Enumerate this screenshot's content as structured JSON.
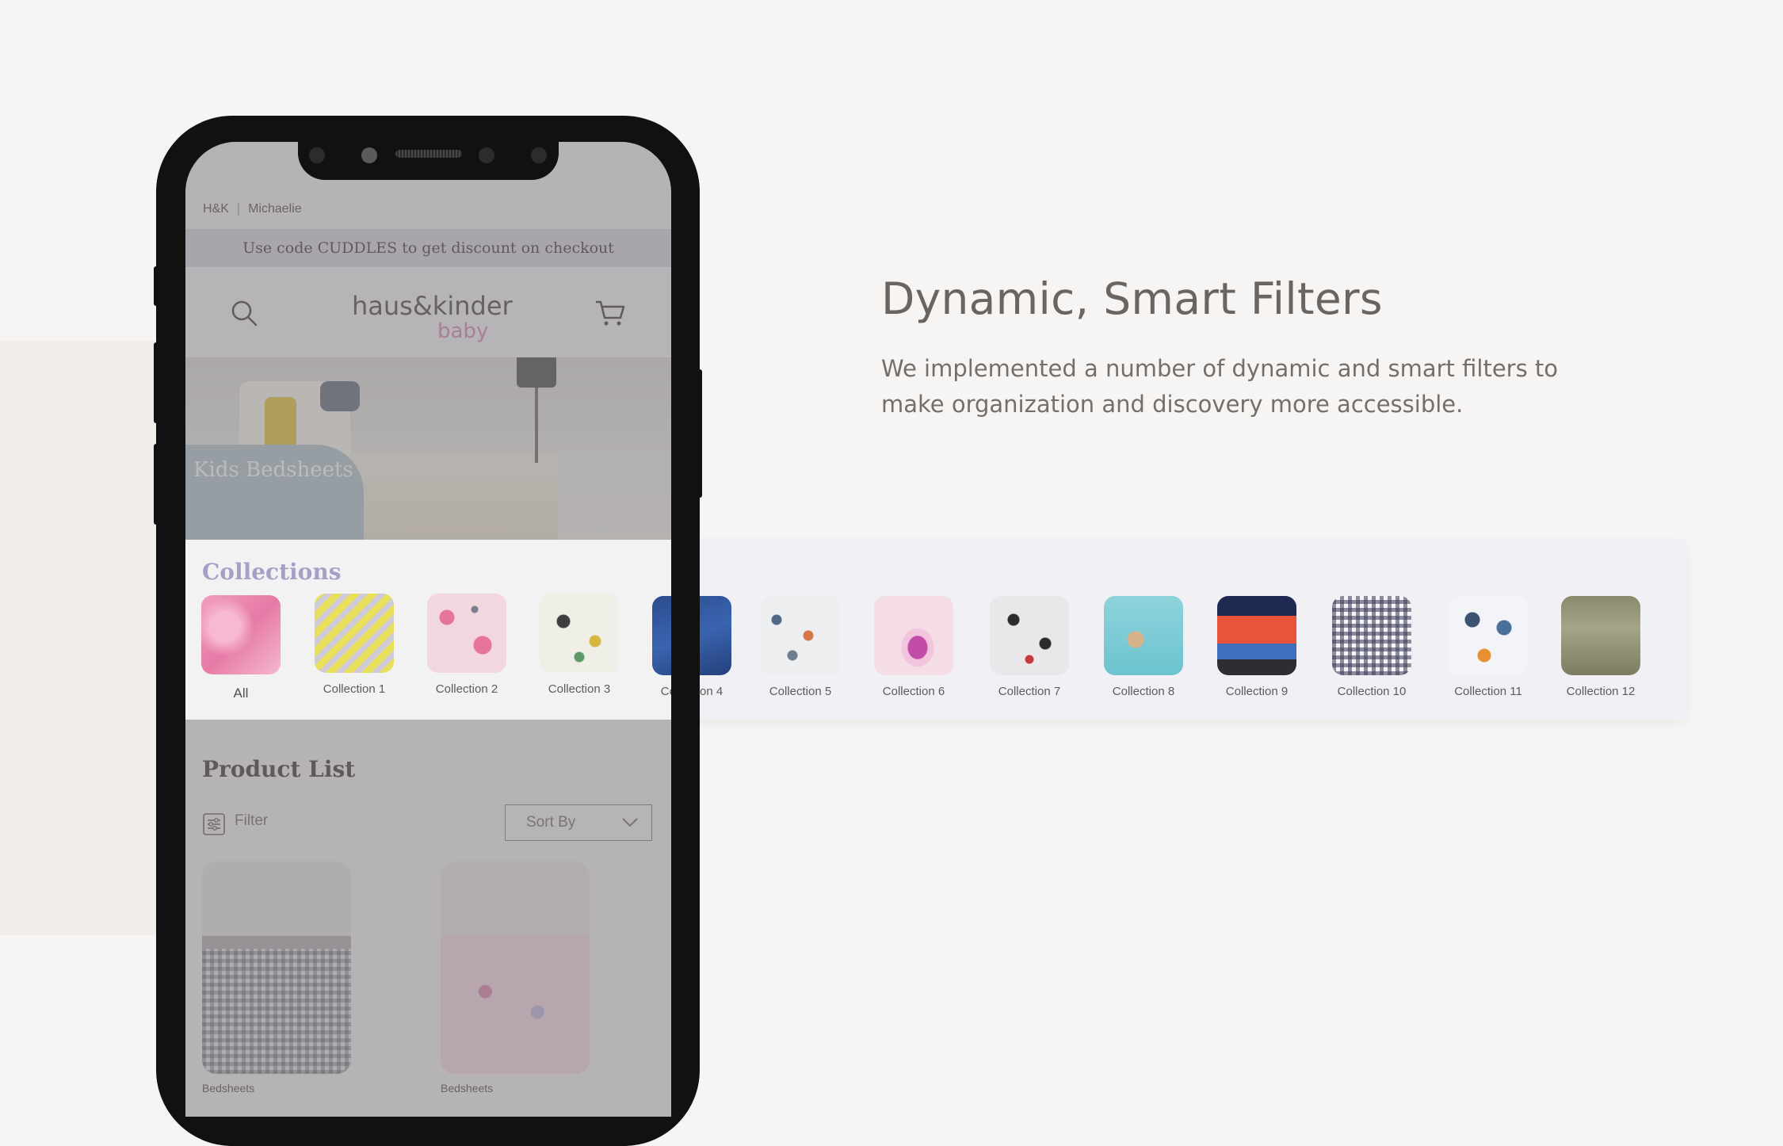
{
  "feature": {
    "title": "Dynamic, Smart Filters",
    "description": "We implemented a number of dynamic and smart filters to make organization and discovery more accessible."
  },
  "phone": {
    "topbar": {
      "brand": "H&K",
      "sub": "Michaelie"
    },
    "promo": "Use code CUDDLES to get discount on checkout",
    "logo": {
      "main": "haus&kinder",
      "sub": "baby"
    },
    "hero_title": "Kids Bedsheets",
    "product_list": {
      "title": "Product List",
      "filter_label": "Filter",
      "sort_label": "Sort By",
      "items": [
        {
          "caption": "Bedsheets"
        },
        {
          "caption": "Bedsheets"
        }
      ]
    }
  },
  "collections": {
    "title": "Collections",
    "items": [
      {
        "label": "All"
      },
      {
        "label": "Collection 1"
      },
      {
        "label": "Collection 2"
      },
      {
        "label": "Collection 3"
      },
      {
        "label": "Collection 4"
      },
      {
        "label": "Collection 5"
      },
      {
        "label": "Collection 6"
      },
      {
        "label": "Collection 7"
      },
      {
        "label": "Collection 8"
      },
      {
        "label": "Collection 9"
      },
      {
        "label": "Collection 10"
      },
      {
        "label": "Collection 11"
      },
      {
        "label": "Collection 12"
      }
    ]
  },
  "icons": {
    "search": "search-icon",
    "cart": "cart-icon",
    "filter": "filter-sliders-icon",
    "sort": "chevron-down-icon"
  },
  "colors": {
    "background": "#f6f5f3",
    "heading_text": "#6b6562",
    "collections_title": "#a89fc6",
    "strip_background": "#f1f0f4",
    "promo_bar": "#dbd6e3",
    "logo_accent": "#d98fb2"
  }
}
